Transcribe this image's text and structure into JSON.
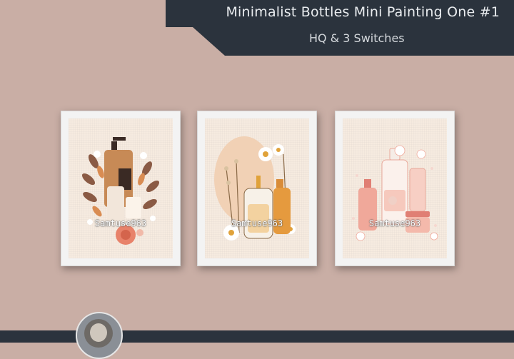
{
  "banner": {
    "title": "Minimalist Bottles Mini Painting One #1",
    "subtitle": "HQ & 3 Switches"
  },
  "paintings": [
    {
      "watermark": "Samtuse963"
    },
    {
      "watermark": "Samtuse963"
    },
    {
      "watermark": "Samtuse963"
    }
  ],
  "colors": {
    "wall": "#c9aea5",
    "banner": "#2b333d",
    "frame": "#f3f3f3",
    "mat": "#f6ebe0"
  }
}
